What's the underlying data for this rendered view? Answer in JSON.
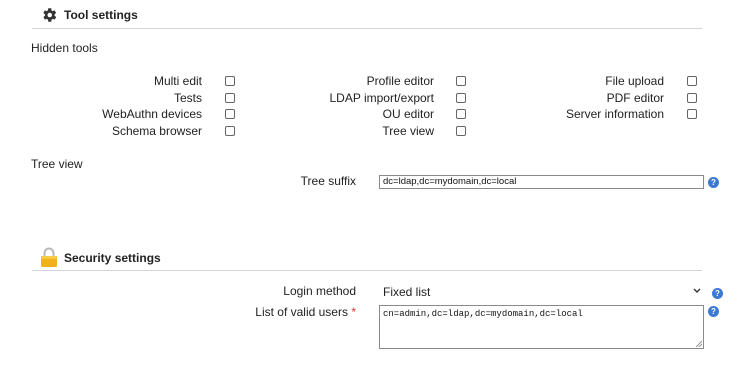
{
  "tool_settings": {
    "title": "Tool settings",
    "icon": "gear-icon",
    "hidden_tools_label": "Hidden tools",
    "tools": [
      {
        "label": "Multi edit",
        "checked": false
      },
      {
        "label": "Tests",
        "checked": false
      },
      {
        "label": "WebAuthn devices",
        "checked": false
      },
      {
        "label": "Schema browser",
        "checked": false
      },
      {
        "label": "Profile editor",
        "checked": false
      },
      {
        "label": "LDAP import/export",
        "checked": false
      },
      {
        "label": "OU editor",
        "checked": false
      },
      {
        "label": "Tree view",
        "checked": false
      },
      {
        "label": "File upload",
        "checked": false
      },
      {
        "label": "PDF editor",
        "checked": false
      },
      {
        "label": "Server information",
        "checked": false
      }
    ],
    "tree_view": {
      "section_label": "Tree view",
      "suffix_label": "Tree suffix",
      "suffix_value": "dc=ldap,dc=mydomain,dc=local"
    }
  },
  "security_settings": {
    "title": "Security settings",
    "icon": "lock-icon",
    "login_method_label": "Login method",
    "login_method_value": "Fixed list",
    "valid_users_label": "List of valid users",
    "required_mark": "*",
    "valid_users_value": "cn=admin,dc=ldap,dc=mydomain,dc=local"
  },
  "help_glyph": "?",
  "colors": {
    "help_icon": "#3b79d3",
    "required": "#dd3333",
    "rule": "#d4d4d4"
  }
}
